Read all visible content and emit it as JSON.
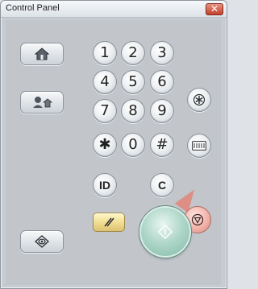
{
  "window": {
    "title": "Control Panel",
    "close_symbol": "✕"
  },
  "keypad": {
    "digits": [
      "1",
      "2",
      "3",
      "4",
      "5",
      "6",
      "7",
      "8",
      "9"
    ],
    "zero": "0",
    "star_symbol": "✱",
    "hash_symbol": "#",
    "id_label": "ID",
    "c_label": "C"
  },
  "buttons": {
    "home_icon": "home-icon",
    "user_swap_icon": "user-switch-icon",
    "settings_icon": "settings-star-icon",
    "counter_icon": "counter-display-icon",
    "view_icon": "eye-diamond-icon",
    "clear_icon": "clear-slash-icon",
    "start_icon": "start-diamond-icon",
    "stop_icon": "stop-octagon-icon"
  },
  "colors": {
    "start_green": "#7fb8a6",
    "stop_red": "#dd8f86",
    "clear_yellow": "#eed98c",
    "titlebar_close_red": "#c4412b"
  }
}
